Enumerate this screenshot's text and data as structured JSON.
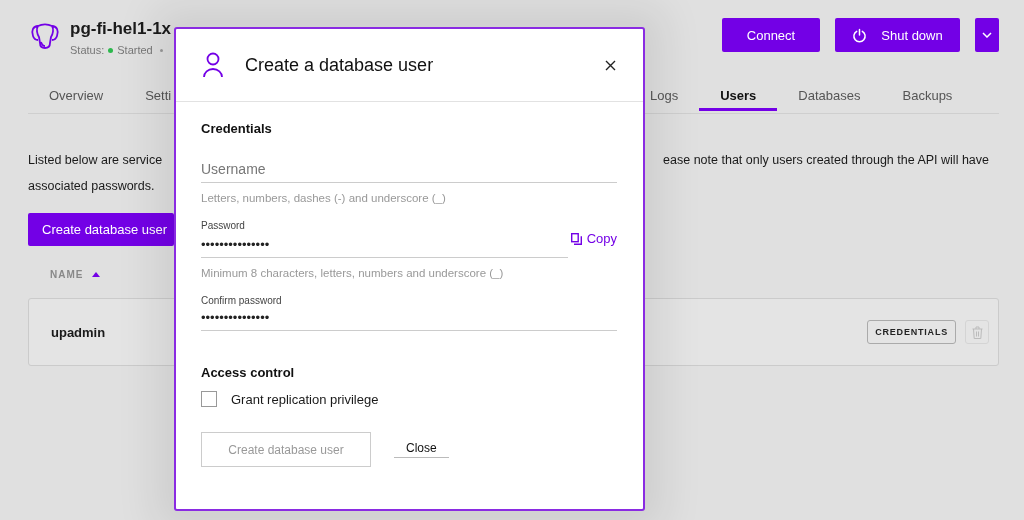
{
  "service": {
    "title": "pg-fi-hel1-1x",
    "status_label": "Status:",
    "status": "Started"
  },
  "header_buttons": [
    {
      "kind": "text",
      "label": "Connect"
    },
    {
      "kind": "power",
      "label": "Shut down"
    },
    {
      "kind": "dropdown"
    }
  ],
  "tabs": [
    {
      "label": "Overview",
      "selected": false
    },
    {
      "label": "Setti",
      "selected": false
    },
    {
      "label": "Logs",
      "selected": false
    },
    {
      "label": "Users",
      "selected": true
    },
    {
      "label": "Databases",
      "selected": false
    },
    {
      "label": "Backups",
      "selected": false
    }
  ],
  "description": {
    "line_1_left": "Listed below are service",
    "line_1_right": "ease note that only users created through the API will have",
    "line_2": "associated passwords."
  },
  "create_button": "Create database user",
  "table": {
    "columns": [
      {
        "label": "NAME",
        "sorted_ascending": true
      }
    ],
    "rows": [
      {
        "name": "upadmin",
        "action": "CREDENTIALS",
        "delete_disabled": true
      }
    ]
  },
  "dialog": {
    "title": "Create a database user",
    "credentials_heading": "Credentials",
    "fields": [
      {
        "kind": "plain",
        "placeholder": "Username",
        "hint": "Letters, numbers, dashes (-) and underscore (_)"
      },
      {
        "kind": "copyable",
        "label": "Password",
        "value": "•••••••••••••••",
        "copy": "Copy",
        "hint": "Minimum 8 characters, letters, numbers and underscore (_)"
      },
      {
        "kind": "plain",
        "label": "Confirm password",
        "value": "•••••••••••••••"
      }
    ],
    "access_heading": "Access control",
    "checkbox": {
      "label": "Grant replication privilege",
      "checked": false
    },
    "buttons": [
      {
        "kind": "button",
        "label": "Create database user",
        "disabled": true
      },
      {
        "kind": "link",
        "label": "Close"
      }
    ]
  }
}
